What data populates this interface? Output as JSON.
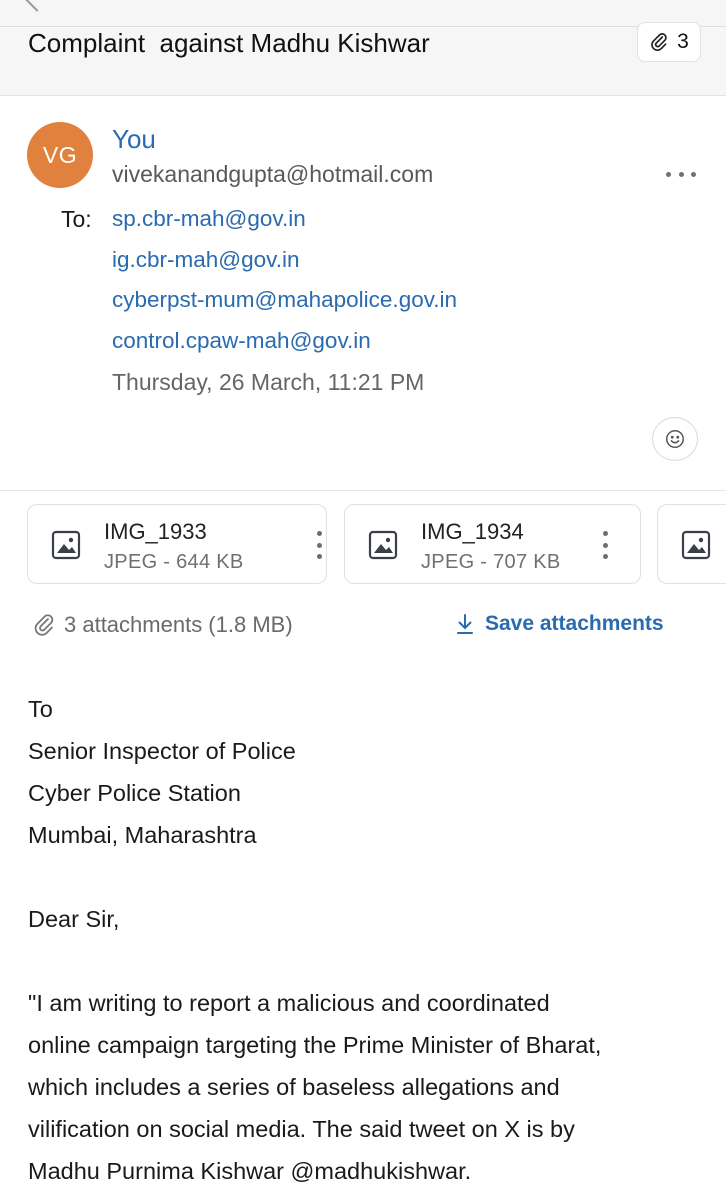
{
  "header": {
    "subject": "Complaint  against Madhu Kishwar",
    "attachment_count": "3"
  },
  "sender": {
    "initials": "VG",
    "name": "You",
    "email": "vivekanandgupta@hotmail.com"
  },
  "recipients": {
    "label": "To:",
    "list": [
      "sp.cbr-mah@gov.in",
      "ig.cbr-mah@gov.in",
      "cyberpst-mum@mahapolice.gov.in",
      "control.cpaw-mah@gov.in"
    ]
  },
  "sent_time": "Thursday, 26 March, 11:21 PM",
  "attachments": {
    "items": [
      {
        "name": "IMG_1933",
        "meta": "JPEG - 644 KB"
      },
      {
        "name": "IMG_1934",
        "meta": "JPEG - 707 KB"
      }
    ],
    "summary": "3 attachments (1.8 MB)",
    "save_label": "Save attachments"
  },
  "body": {
    "address_lines": [
      "To",
      "Senior Inspector of Police",
      "Cyber Police Station",
      "Mumbai, Maharashtra"
    ],
    "greeting": "Dear Sir,",
    "paragraph_lines": [
      "\"I am writing to report a malicious and coordinated",
      "online campaign targeting the Prime Minister of Bharat,",
      "which includes a series of baseless allegations and",
      "vilification on social media. The said tweet on X is by",
      "Madhu Purnima Kishwar @madhukishwar."
    ]
  },
  "colors": {
    "accent": "#2a6bb0",
    "avatar": "#e0813e"
  },
  "icons": [
    "paperclip-icon",
    "more-icon",
    "emoji-icon",
    "image-file-icon",
    "kebab-icon",
    "download-icon"
  ]
}
